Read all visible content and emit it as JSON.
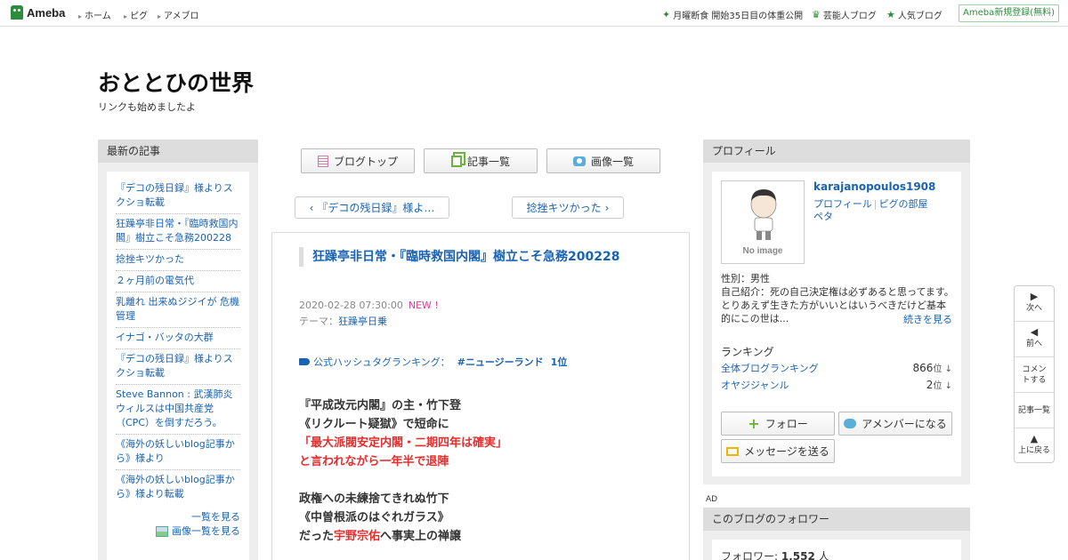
{
  "topbar": {
    "logo": "Ameba",
    "nav": [
      "ホーム",
      "ピグ",
      "アメブロ"
    ],
    "news": "月曜断食 開始35日目の体重公開",
    "celebrity": "芸能人ブログ",
    "popular": "人気ブログ",
    "signup": "Ameba新規登録(無料)"
  },
  "blog": {
    "title": "おととひの世界",
    "description": "リンクも始めましたよ"
  },
  "left": {
    "heading": "最新の記事",
    "items": [
      "『デコの残日録』様よりスクショ転載",
      "狂躁亭非日常・『臨時救国内閣』樹立こそ急務200228",
      "捻挫キツかった",
      "２ヶ月前の電気代",
      "乳離れ 出来ぬジジイが 危機管理",
      "イナゴ・バッタの大群",
      "『デコの残日録』様よりスクショ転載",
      "Steve Bannon : 武漢肺炎ウィルスは中国共産党（CPC）を倒すだろう。",
      "《海外の妖しいblog記事から》様より",
      "《海外の妖しいblog記事から》様より転載"
    ],
    "more": "一覧を見る",
    "images_more": "画像一覧を見る"
  },
  "center": {
    "btn_top": "ブログトップ",
    "btn_list": "記事一覧",
    "btn_images": "画像一覧",
    "prev": "『デコの残日録』様よ…",
    "next": "捻挫キツかった"
  },
  "article": {
    "title": "狂躁亭非日常・『臨時救国内閣』樹立こそ急務200228",
    "date": "2020-02-28 07:30:00",
    "new": "NEW !",
    "theme_label": "テーマ：",
    "theme": "狂躁亭日乗",
    "hashtag_label": "公式ハッシュタグランキング：",
    "hashtag": "#ニュージーランド",
    "hashtag_rank": "1位",
    "lines": [
      {
        "parts": [
          {
            "t": "『平成改元内閣』の主・竹下登",
            "red": false
          }
        ]
      },
      {
        "parts": [
          {
            "t": "《リクルート疑獄》で短命に",
            "red": false
          }
        ]
      },
      {
        "parts": [
          {
            "t": "「最大派閥安定内閣・二期四年は確実」",
            "red": true
          }
        ]
      },
      {
        "parts": [
          {
            "t": "と言われながら一年半で退陣",
            "red": true
          }
        ]
      },
      {
        "parts": []
      },
      {
        "parts": [
          {
            "t": "政権への未練捨てきれぬ竹下",
            "red": false
          }
        ]
      },
      {
        "parts": [
          {
            "t": "《中曽根派のはぐれガラス》",
            "red": false
          }
        ]
      },
      {
        "parts": [
          {
            "t": "だった",
            "red": false
          },
          {
            "t": "宇野宗佑",
            "red": true
          },
          {
            "t": "へ事実上の禅譲",
            "red": false
          }
        ]
      }
    ]
  },
  "right": {
    "heading": "プロフィール",
    "no_image": "No image",
    "username": "karajanopoulos1908",
    "link_profile": "プロフィール",
    "link_pig": "ピグの部屋",
    "link_peta": "ペタ",
    "gender": "性別：男性",
    "intro": "自己紹介：死の自己決定権は必ずあると思ってます。 とりあえず生きた方がいいとはいうべきだけど基本的にこの世は...",
    "more": "続きを見る",
    "ranking_heading": "ランキング",
    "rank1_label": "全体ブログランキング",
    "rank1_value": "866",
    "rank2_label": "オヤジジャンル",
    "rank2_value": "2",
    "rank_unit": "位",
    "btn_follow": "フォロー",
    "btn_member": "アメンバーになる",
    "btn_message": "メッセージを送る",
    "ad": "AD",
    "followers_heading": "このブログのフォロワー",
    "followers_label": "フォロワー: ",
    "followers_count": "1,552",
    "followers_unit": " 人"
  },
  "floatnav": {
    "next": "次へ",
    "prev": "前へ",
    "comment": "コメントする",
    "list": "記事一覧",
    "top": "上に戻る"
  }
}
